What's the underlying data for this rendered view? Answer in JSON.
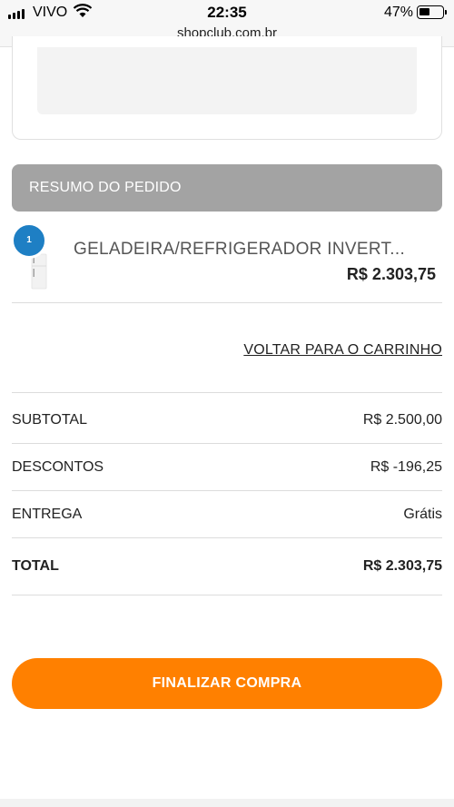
{
  "status_bar": {
    "carrier": "VIVO",
    "time": "22:35",
    "battery_percent": "47%",
    "battery_level": 0.47,
    "icons": [
      "signal-icon",
      "wifi-icon",
      "battery-icon"
    ]
  },
  "browser": {
    "url": "shopclub.com.br"
  },
  "summary": {
    "header": "RESUMO DO PEDIDO",
    "item": {
      "quantity": "1",
      "name": "GELADEIRA/REFRIGERADOR INVERT...",
      "price": "R$ 2.303,75"
    },
    "back_link": "VOLTAR PARA O CARRINHO"
  },
  "totals": {
    "subtotal_label": "SUBTOTAL",
    "subtotal_value": "R$ 2.500,00",
    "discount_label": "DESCONTOS",
    "discount_value": "R$ -196,25",
    "delivery_label": "ENTREGA",
    "delivery_value": "Grátis",
    "total_label": "TOTAL",
    "total_value": "R$ 2.303,75"
  },
  "checkout": {
    "button_label": "FINALIZAR COMPRA"
  },
  "colors": {
    "accent": "#ff8000",
    "badge": "#1e7fc4",
    "summary_header": "#a3a3a3"
  }
}
